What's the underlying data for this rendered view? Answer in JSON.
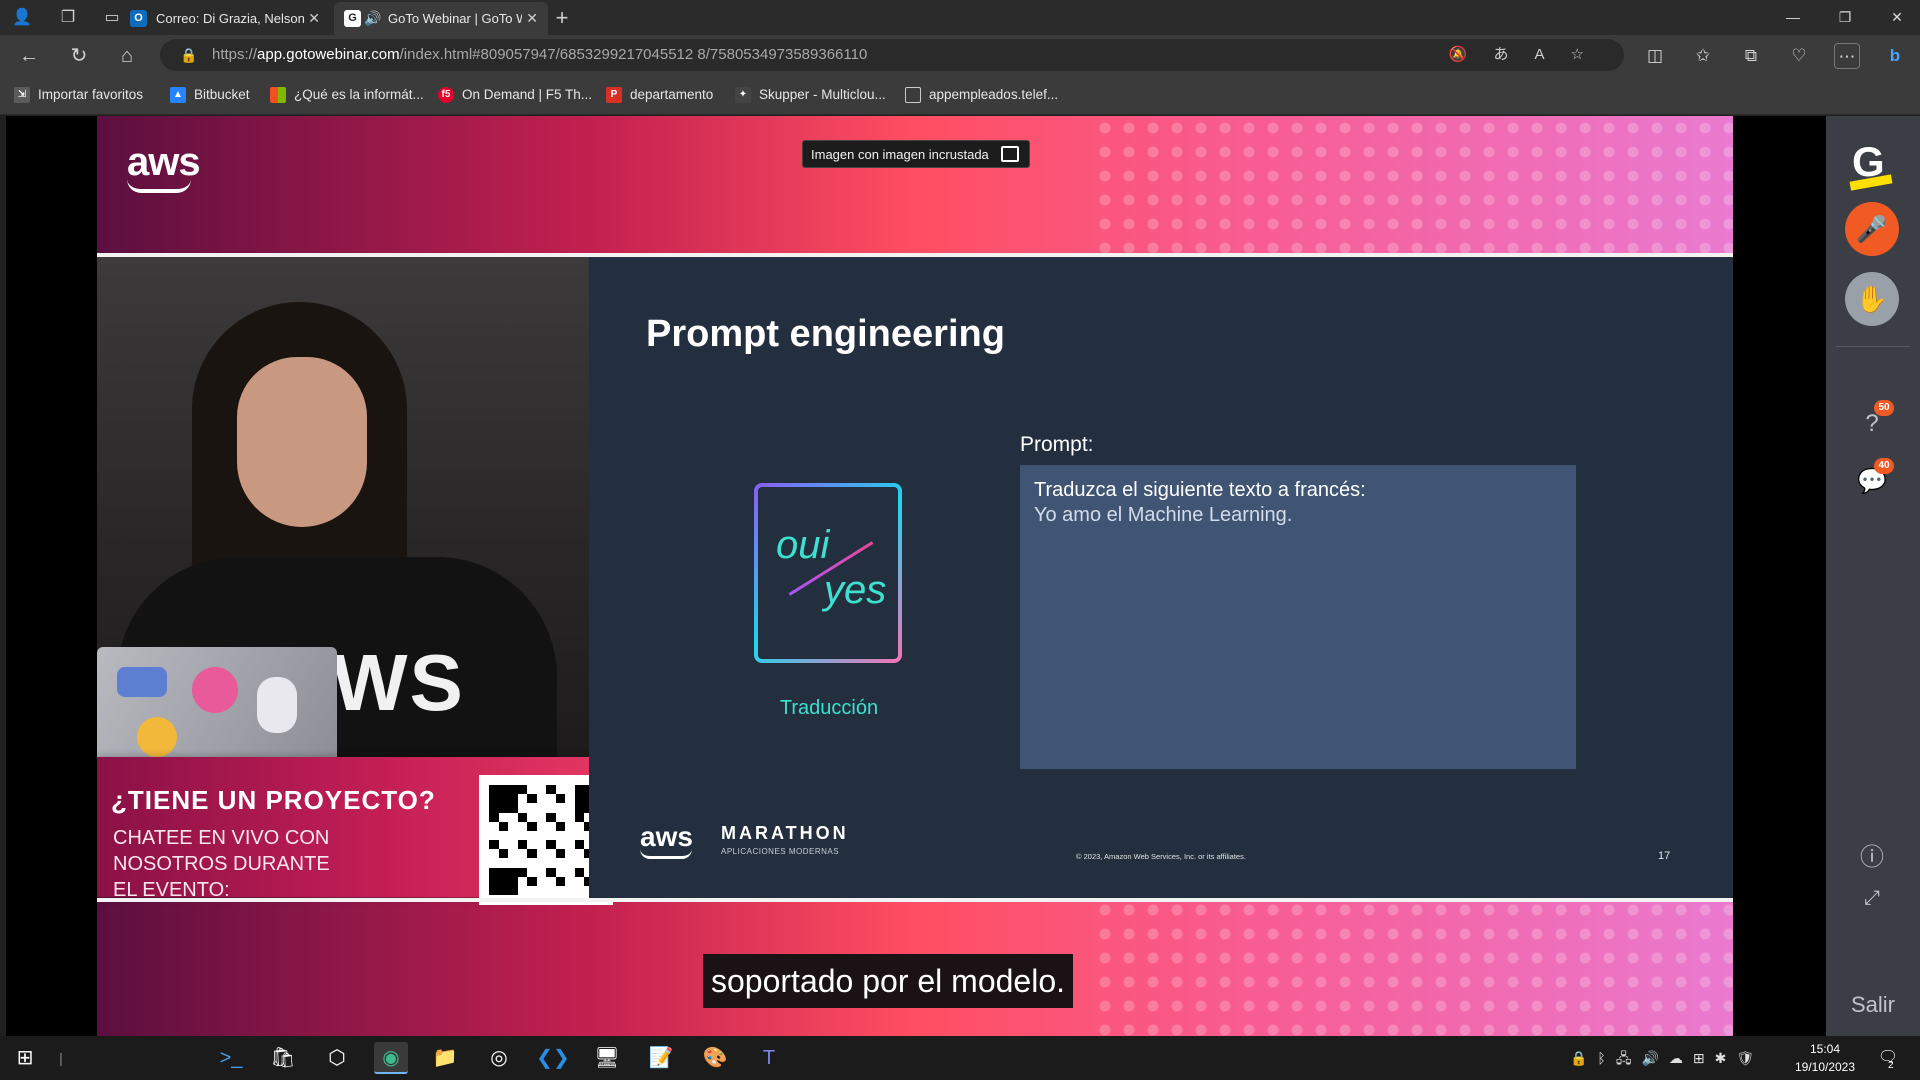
{
  "browser": {
    "tabs": [
      {
        "title": "Correo: Di Grazia, Nelson - Outlook",
        "favicon": "outlook-icon",
        "favicon_color": "#0f6cbd"
      },
      {
        "title": "GoTo Webinar | GoTo Webinar",
        "favicon": "goto-icon",
        "favicon_color": "#ffffff"
      }
    ],
    "new_tab": "+",
    "url_scheme": "https://",
    "url_host": "app.gotowebinar.com",
    "url_path": "/index.html#809057947/6853299217045512 8/7580534973589366110",
    "bookmarks": [
      {
        "label": "Importar favoritos",
        "icon": "import-icon",
        "color": "#5b5b5b"
      },
      {
        "label": "Bitbucket",
        "icon": "bitbucket-icon",
        "color": "#2684ff"
      },
      {
        "label": "¿Qué es la informát...",
        "icon": "windows-logo-icon",
        "color": "#00a4ef"
      },
      {
        "label": "On Demand | F5 Th...",
        "icon": "f5-icon",
        "color": "#e4002b"
      },
      {
        "label": "departamento",
        "icon": "pdf-icon",
        "color": "#d93025"
      },
      {
        "label": "Skupper - Multiclou...",
        "icon": "skupper-icon",
        "color": "#444444"
      },
      {
        "label": "appempleados.telef...",
        "icon": "page-icon",
        "color": "#5b5b5b"
      }
    ]
  },
  "webinar": {
    "pip_label": "Imagen con imagen incrustada",
    "aws_logo": "aws",
    "promo": {
      "title": "¿TIENE UN PROYECTO?",
      "line1": "CHATEE EN VIVO CON",
      "line2": "NOSOTROS DURANTE",
      "line3": "EL EVENTO:"
    },
    "shirt_text": "WS",
    "slide": {
      "title": "Prompt engineering",
      "card_word1": "oui",
      "card_word2": "yes",
      "card_caption": "Traducción",
      "prompt_label": "Prompt:",
      "prompt_line1": "Traduzca el siguiente texto a francés:",
      "prompt_line2": "Yo amo el Machine Learning.",
      "footer_logo": "aws",
      "footer_title": "MARATHON",
      "footer_sub": "APLICACIONES MODERNAS",
      "copyright": "© 2023, Amazon Web Services, Inc. or its affiliates.",
      "page_number": "17"
    },
    "subtitle": "soportado por el modelo.",
    "rail": {
      "logo": "G",
      "questions_count": "50",
      "chat_count": "40",
      "exit_label": "Salir"
    }
  },
  "taskbar": {
    "time": "15:04",
    "date": "19/10/2023",
    "notifications": "2"
  }
}
